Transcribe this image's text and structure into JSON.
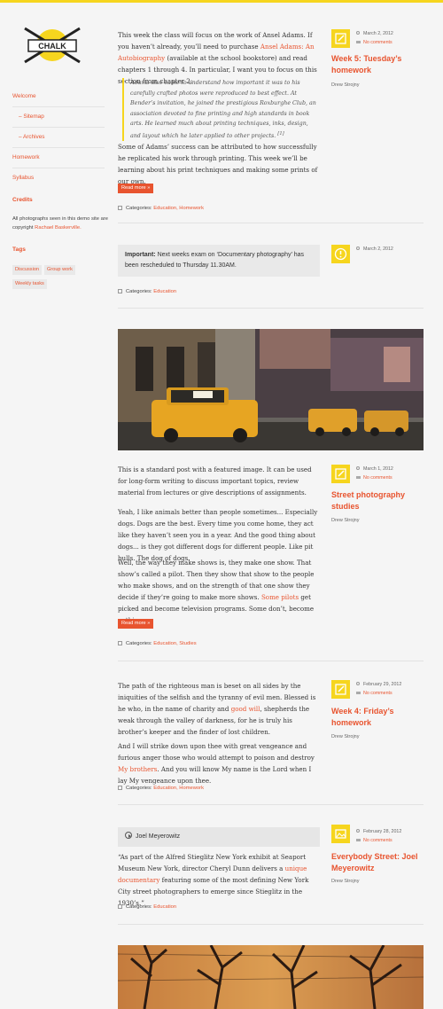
{
  "site": {
    "logo_text": "CHALK"
  },
  "sidebar": {
    "nav": [
      {
        "label": "Welcome"
      },
      {
        "label": "Sitemap"
      },
      {
        "label": "Archives"
      },
      {
        "label": "Homework"
      },
      {
        "label": "Syllabus"
      }
    ],
    "credits_heading": "Credits",
    "credits_text_1": "All photographs seen in this demo site are copyright",
    "credits_link": "Rachael Baskerville.",
    "tags_heading": "Tags",
    "tags": [
      "Discussion",
      "Group work",
      "Weekly tasks"
    ]
  },
  "posts": [
    {
      "body_1_a": "This week the class will focus on the work of Ansel Adams. If you haven’t already, you’ll need to purchase",
      "body_1_link": "Ansel Adams: An Autobiography",
      "body_1_b": "(available at the school bookstore) and read chapters 1 through 4. In particular, I want you to focus on this section from chapter 2:",
      "quote": "Adams also came to understand how important it was to his carefully crafted photos were reproduced to best effect. At Bender’s invitation, he joined the prestigious Roxburghe Club, an association devoted to fine printing and high standards in book arts. He learned much about printing techniques, inks, design, and layout which he later applied to other projects.",
      "quote_ref": "[1]",
      "body_2": "Some of Adams’ success can be attributed to how successfully he replicated his work through printing. This week we’ll be learning about his print techniques and making some prints of our own.",
      "read_more": "Read more »",
      "categories_label": "Categories:",
      "categories": "Education, Homework",
      "date": "March 2, 2012",
      "comments": "No comments",
      "title": "Week 5: Tuesday’s homework",
      "author": "Drew Strojny"
    },
    {
      "notice_strong": "Important:",
      "notice_text": "Next weeks exam on ‘Documentary photography’ has been rescheduled to Thursday 11.30AM.",
      "categories_label": "Categories:",
      "categories": "Education",
      "date": "March 2, 2012"
    },
    {
      "body_1": "This is a standard post with a featured image. It can be used for long-form writing to discuss important topics, review material from lectures or give descriptions of assignments.",
      "body_2": "Yeah, I like animals better than people sometimes... Especially dogs. Dogs are the best. Every time you come home, they act like they haven’t seen you in a year. And the good thing about dogs... is they got different dogs for different people. Like pit bulls. The dog of dogs.",
      "body_3_a": "Well, the way they make shows is, they make one show. That show’s called a pilot. Then they show that show to the people who make shows, and on the strength of that one show they decide if they’re going to make more shows.",
      "body_3_link": "Some pilots",
      "body_3_b": "get picked and become television programs. Some don’t, become nothing.",
      "read_more": "Read more »",
      "categories_label": "Categories:",
      "categories": "Education, Studies",
      "date": "March 1, 2012",
      "comments": "No comments",
      "title": "Street photography studies",
      "author": "Drew Strojny"
    },
    {
      "body_1_a": "The path of the righteous man is beset on all sides by the iniquities of the selfish and the tyranny of evil men. Blessed is he who, in the name of charity and",
      "body_1_link": "good will",
      "body_1_b": ", shepherds the weak through the valley of darkness, for he is truly his brother’s keeper and the finder of lost children.",
      "body_2_a": "And I will strike down upon thee with great vengeance and furious anger those who would attempt to poison and destroy",
      "body_2_link": "My brothers",
      "body_2_b": ". And you will know My name is the Lord when I lay My vengeance upon thee.",
      "categories_label": "Categories:",
      "categories": "Education, Homework",
      "date": "February 29, 2012",
      "comments": "No comments",
      "title": "Week 4: Friday’s homework",
      "author": "Drew Strojny"
    },
    {
      "audio_label": "Joel Meyerowitz",
      "body_1_a": "“As part of the Alfred Stieglitz New York exhibit at Seaport Museum New York, director Cheryl Dunn delivers a",
      "body_1_link": "unique documentary",
      "body_1_b": "featuring some of the most defining New York City street photographers to emerge since Stieglitz in the 1930’s.”",
      "categories_label": "Categories:",
      "categories": "Education",
      "date": "February 28, 2012",
      "comments": "No comments",
      "title": "Everybody Street: Joel Meyerowitz",
      "author": "Drew Strojny"
    }
  ],
  "icons": {
    "post_format_1": "pencil-icon",
    "post_format_2": "alert-icon",
    "post_format_3": "pencil-icon",
    "post_format_4": "pencil-icon",
    "post_format_5": "video-icon"
  },
  "colors": {
    "accent": "#e8542f",
    "yellow": "#f6d51e",
    "background": "#f5f5f5"
  }
}
